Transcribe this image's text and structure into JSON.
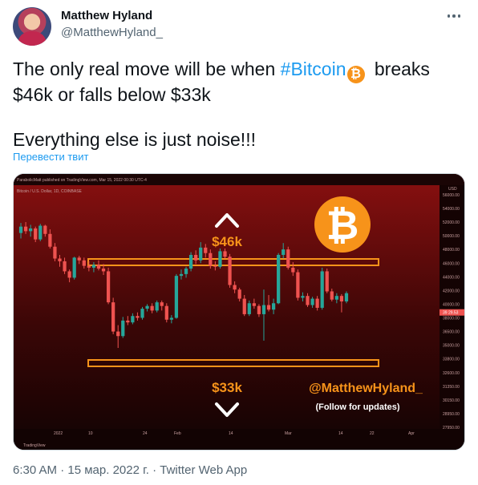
{
  "author": {
    "name": "Matthew Hyland",
    "handle": "@MatthewHyland_"
  },
  "tweet": {
    "text_before_tag": "The only real move will be when ",
    "hashtag": "#Bitcoin",
    "emoji_icon": "bitcoin-icon",
    "text_after_tag": " breaks",
    "line2": "$46k or falls below $33k",
    "line3": "Everything else is just noise!!!",
    "translate_label": "Перевести твит"
  },
  "chart_image": {
    "header_text": "ParabolicMatt published on TradingView.com, Mar 15, 2022 00:30 UTC-4",
    "symbol_text": "Bitcoin / U.S. Dollar, 1D, COINBASE",
    "currency": "USD",
    "label_46k": "$46k",
    "label_33k": "$33k",
    "watermark_handle": "@MatthewHyland_",
    "watermark_sub": "(Follow for updates)",
    "tradingview_logo": "TradingView",
    "x_tick_labels": [
      "2022",
      "10",
      "24",
      "Feb",
      "14",
      "Mar",
      "14",
      "22",
      "Apr"
    ],
    "price_ticks": [
      "56000.00",
      "54000.00",
      "52000.00",
      "50000.00",
      "48000.00",
      "46000.00",
      "44000.00",
      "42000.00",
      "40000.00",
      "38000.00",
      "36500.00",
      "35000.00",
      "33800.00",
      "32600.00",
      "31350.00",
      "30150.00",
      "28950.00",
      "27950.00"
    ],
    "current_price_tag": "39 29.53",
    "colors": {
      "up": "#26a69a",
      "down": "#ef5350",
      "level": "#f7931a",
      "bg_top": "#7a0c0c",
      "bg_bottom": "#140404"
    }
  },
  "chart_data": {
    "type": "candlestick",
    "title": "",
    "symbol": "Bitcoin / U.S. Dollar, 1D, COINBASE",
    "ylim": [
      27950,
      56000
    ],
    "levels": [
      46000,
      33000
    ],
    "candles": [
      {
        "o": 46300,
        "h": 47400,
        "l": 45700,
        "c": 47000
      },
      {
        "o": 47000,
        "h": 47500,
        "l": 46200,
        "c": 46500
      },
      {
        "o": 46500,
        "h": 47200,
        "l": 45900,
        "c": 46800
      },
      {
        "o": 46800,
        "h": 47000,
        "l": 45300,
        "c": 45600
      },
      {
        "o": 45600,
        "h": 47300,
        "l": 45400,
        "c": 47100
      },
      {
        "o": 47100,
        "h": 47200,
        "l": 45900,
        "c": 46200
      },
      {
        "o": 46200,
        "h": 46700,
        "l": 44600,
        "c": 44800
      },
      {
        "o": 44800,
        "h": 45200,
        "l": 43200,
        "c": 43500
      },
      {
        "o": 43500,
        "h": 43900,
        "l": 42600,
        "c": 43200
      },
      {
        "o": 43200,
        "h": 43600,
        "l": 41800,
        "c": 42100
      },
      {
        "o": 42100,
        "h": 42300,
        "l": 40900,
        "c": 41400
      },
      {
        "o": 41400,
        "h": 43700,
        "l": 41200,
        "c": 43600
      },
      {
        "o": 43600,
        "h": 43800,
        "l": 42900,
        "c": 43300
      },
      {
        "o": 43300,
        "h": 43600,
        "l": 42400,
        "c": 42700
      },
      {
        "o": 42700,
        "h": 43200,
        "l": 42100,
        "c": 42500
      },
      {
        "o": 42500,
        "h": 43100,
        "l": 42000,
        "c": 42800
      },
      {
        "o": 42800,
        "h": 43300,
        "l": 42200,
        "c": 42400
      },
      {
        "o": 42400,
        "h": 42900,
        "l": 41700,
        "c": 42100
      },
      {
        "o": 42100,
        "h": 42500,
        "l": 38500,
        "c": 38700
      },
      {
        "o": 38700,
        "h": 39200,
        "l": 35200,
        "c": 35500
      },
      {
        "o": 35500,
        "h": 36200,
        "l": 33700,
        "c": 35000
      },
      {
        "o": 35000,
        "h": 37100,
        "l": 34800,
        "c": 36700
      },
      {
        "o": 36700,
        "h": 37200,
        "l": 36200,
        "c": 36500
      },
      {
        "o": 36500,
        "h": 37500,
        "l": 36300,
        "c": 37200
      },
      {
        "o": 37200,
        "h": 37600,
        "l": 36700,
        "c": 37000
      },
      {
        "o": 37000,
        "h": 38200,
        "l": 36800,
        "c": 38000
      },
      {
        "o": 38000,
        "h": 38500,
        "l": 37700,
        "c": 38300
      },
      {
        "o": 38300,
        "h": 38600,
        "l": 37500,
        "c": 37800
      },
      {
        "o": 37800,
        "h": 38900,
        "l": 37600,
        "c": 38700
      },
      {
        "o": 38700,
        "h": 38900,
        "l": 37800,
        "c": 38300
      },
      {
        "o": 38300,
        "h": 38600,
        "l": 36500,
        "c": 36800
      },
      {
        "o": 36800,
        "h": 37300,
        "l": 36400,
        "c": 37000
      },
      {
        "o": 37000,
        "h": 41800,
        "l": 36900,
        "c": 41600
      },
      {
        "o": 41600,
        "h": 42300,
        "l": 41200,
        "c": 41800
      },
      {
        "o": 41800,
        "h": 42600,
        "l": 41400,
        "c": 42400
      },
      {
        "o": 42400,
        "h": 44200,
        "l": 42100,
        "c": 43900
      },
      {
        "o": 43900,
        "h": 44400,
        "l": 42900,
        "c": 43300
      },
      {
        "o": 43300,
        "h": 45300,
        "l": 43000,
        "c": 44700
      },
      {
        "o": 44700,
        "h": 45100,
        "l": 43600,
        "c": 44100
      },
      {
        "o": 44100,
        "h": 44500,
        "l": 42400,
        "c": 42700
      },
      {
        "o": 42700,
        "h": 43200,
        "l": 42200,
        "c": 42600
      },
      {
        "o": 42600,
        "h": 44600,
        "l": 42400,
        "c": 44300
      },
      {
        "o": 44300,
        "h": 44600,
        "l": 43500,
        "c": 43700
      },
      {
        "o": 43700,
        "h": 44000,
        "l": 40300,
        "c": 40600
      },
      {
        "o": 40600,
        "h": 41000,
        "l": 39700,
        "c": 40100
      },
      {
        "o": 40100,
        "h": 40300,
        "l": 38800,
        "c": 39100
      },
      {
        "o": 39100,
        "h": 39500,
        "l": 37200,
        "c": 37400
      },
      {
        "o": 37400,
        "h": 38900,
        "l": 37200,
        "c": 38600
      },
      {
        "o": 38600,
        "h": 39100,
        "l": 38000,
        "c": 38300
      },
      {
        "o": 38300,
        "h": 38500,
        "l": 37100,
        "c": 37400
      },
      {
        "o": 37400,
        "h": 40100,
        "l": 34500,
        "c": 38400
      },
      {
        "o": 38400,
        "h": 39500,
        "l": 37700,
        "c": 37900
      },
      {
        "o": 37900,
        "h": 39100,
        "l": 37400,
        "c": 38600
      },
      {
        "o": 38600,
        "h": 44100,
        "l": 38500,
        "c": 43900
      },
      {
        "o": 43900,
        "h": 45200,
        "l": 43500,
        "c": 44500
      },
      {
        "o": 44500,
        "h": 44800,
        "l": 42300,
        "c": 42500
      },
      {
        "o": 42500,
        "h": 43100,
        "l": 41600,
        "c": 42000
      },
      {
        "o": 42000,
        "h": 42300,
        "l": 38900,
        "c": 39200
      },
      {
        "o": 39200,
        "h": 39800,
        "l": 38800,
        "c": 39400
      },
      {
        "o": 39400,
        "h": 39700,
        "l": 38200,
        "c": 38400
      },
      {
        "o": 38400,
        "h": 39300,
        "l": 38100,
        "c": 39100
      },
      {
        "o": 39100,
        "h": 39400,
        "l": 37800,
        "c": 38100
      },
      {
        "o": 38100,
        "h": 42500,
        "l": 37900,
        "c": 42100
      },
      {
        "o": 42100,
        "h": 42400,
        "l": 39700,
        "c": 39900
      },
      {
        "o": 39900,
        "h": 40200,
        "l": 38800,
        "c": 39000
      },
      {
        "o": 39000,
        "h": 39700,
        "l": 38600,
        "c": 39400
      },
      {
        "o": 39400,
        "h": 39600,
        "l": 37600,
        "c": 38800
      },
      {
        "o": 38800,
        "h": 39900,
        "l": 38600,
        "c": 39700
      }
    ]
  },
  "footer": {
    "time": "6:30 AM",
    "date": "15 мар. 2022 г.",
    "app": "Twitter Web App"
  }
}
